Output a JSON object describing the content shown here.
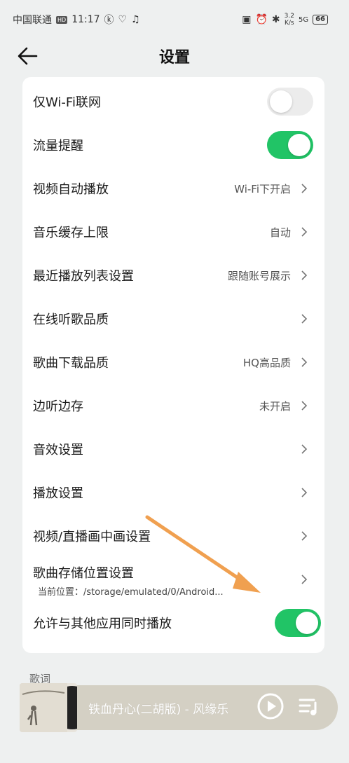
{
  "status_bar": {
    "carrier": "中国联通",
    "hd": "HD",
    "time": "11:17",
    "speed_value": "3.2",
    "speed_unit": "K/s",
    "signal": "5G",
    "battery": "66"
  },
  "header": {
    "title": "设置"
  },
  "settings": [
    {
      "label": "仅Wi-Fi联网",
      "type": "toggle",
      "on": false
    },
    {
      "label": "流量提醒",
      "type": "toggle",
      "on": true
    },
    {
      "label": "视频自动播放",
      "value": "Wi-Fi下开启"
    },
    {
      "label": "音乐缓存上限",
      "value": "自动"
    },
    {
      "label": "最近播放列表设置",
      "value": "跟随账号展示"
    },
    {
      "label": "在线听歌品质",
      "value": ""
    },
    {
      "label": "歌曲下载品质",
      "value": "HQ高品质"
    },
    {
      "label": "边听边存",
      "value": "未开启"
    },
    {
      "label": "音效设置",
      "value": ""
    },
    {
      "label": "播放设置",
      "value": ""
    },
    {
      "label": "视频/直播画中画设置",
      "value": ""
    },
    {
      "label": "歌曲存储位置设置",
      "value": "",
      "sub": "当前位置：/storage/emulated/0/Android..."
    },
    {
      "label": "允许与其他应用同时播放",
      "type": "toggle",
      "on": true
    }
  ],
  "section": {
    "lyrics_label": "歌词"
  },
  "player": {
    "song_title": "铁血丹心(二胡版) - 风缘乐"
  },
  "colors": {
    "toggle_on": "#21c466",
    "toggle_off": "#ececec",
    "annotation_arrow": "#f0a050"
  }
}
